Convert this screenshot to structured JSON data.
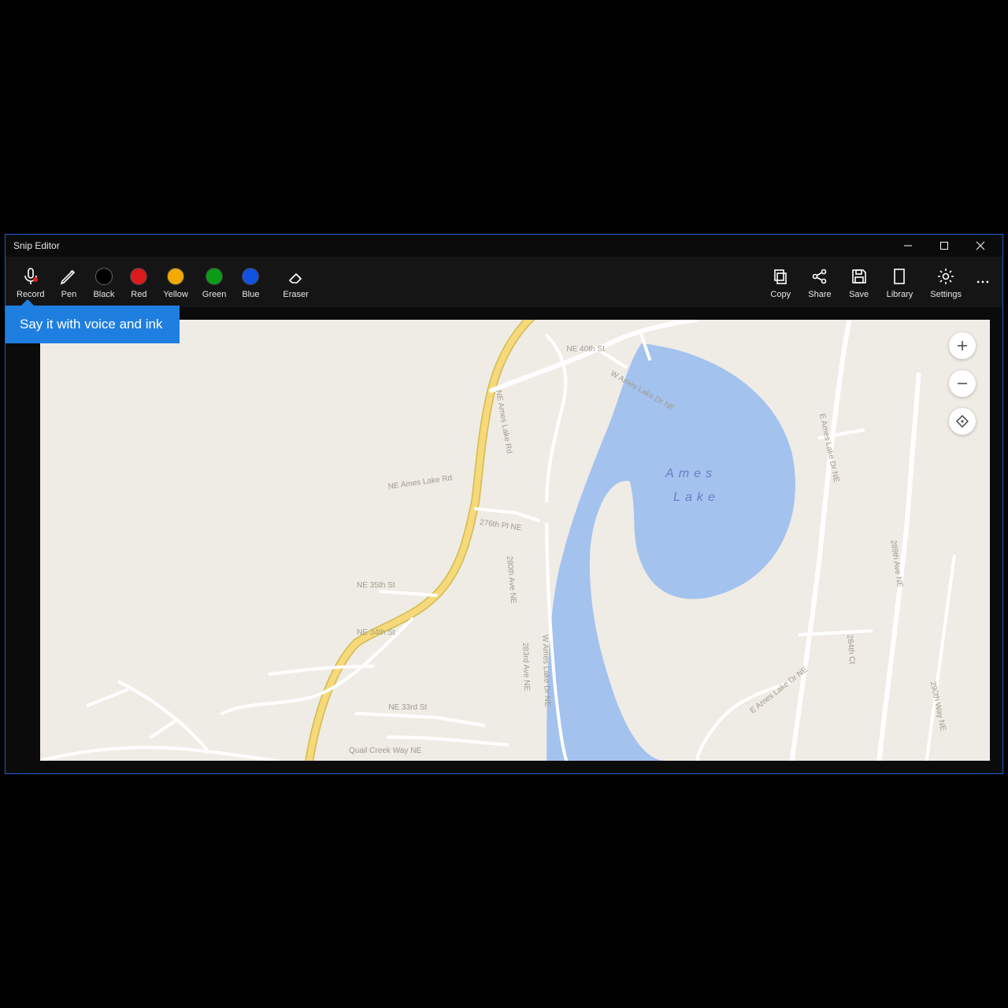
{
  "window": {
    "title": "Snip Editor"
  },
  "toolbar": {
    "record": "Record",
    "pen": "Pen",
    "black": "Black",
    "red": "Red",
    "yellow": "Yellow",
    "green": "Green",
    "blue": "Blue",
    "eraser": "Eraser",
    "copy": "Copy",
    "share": "Share",
    "save": "Save",
    "library": "Library",
    "settings": "Settings"
  },
  "colors": {
    "black": "#000000",
    "red": "#d91b1e",
    "yellow": "#f2a900",
    "green": "#0a9b17",
    "blue": "#1153e0",
    "accent": "#1e7fe0"
  },
  "tooltip": {
    "text": "Say it with voice and ink"
  },
  "map": {
    "lake_label": "Ames Lake",
    "roads": [
      "NE Ames Lake Rd",
      "NE 40th St",
      "W Ames Lake Dr NE",
      "E Ames Lake Dr NE",
      "276th Pl NE",
      "NE 35th St",
      "280th Ave NE",
      "283rd Ave NE",
      "NE 34th St",
      "W Ames Lake Dr NE",
      "284th Ct",
      "289th Ave NE",
      "290th Way NE",
      "NE 33rd St",
      "Quail Creek Way NE",
      "E Ames Lake Dr NE"
    ],
    "controls": {
      "zoom_in": "+",
      "zoom_out": "−",
      "locate": "◈"
    }
  }
}
